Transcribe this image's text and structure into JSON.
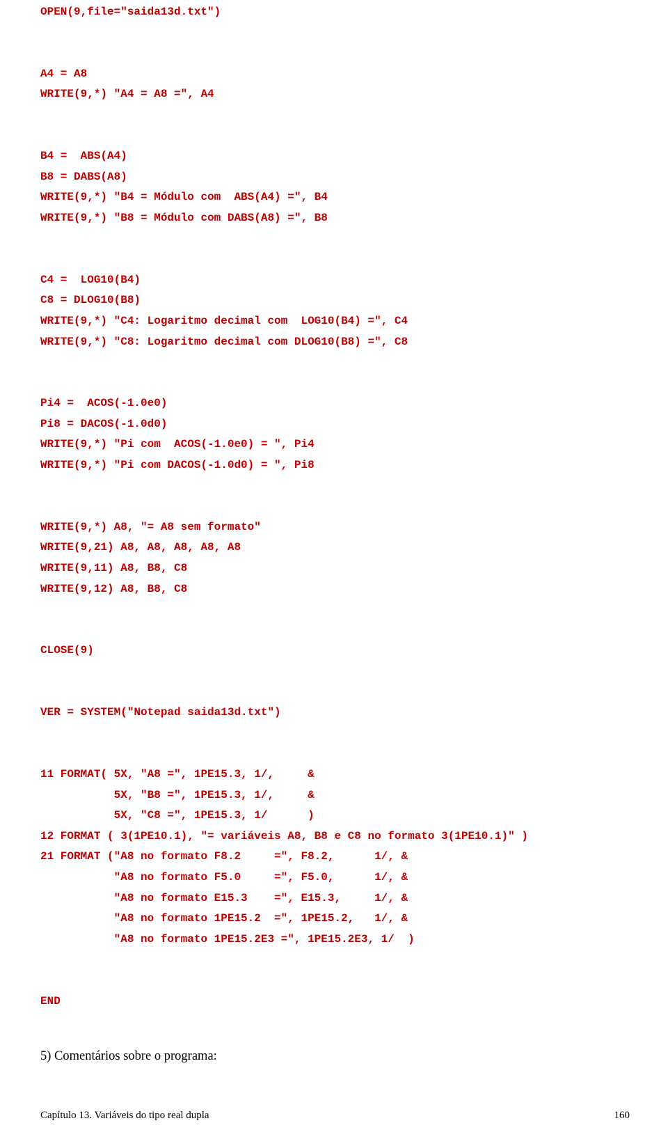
{
  "code": {
    "l01": "OPEN(9,file=\"saida13d.txt\")",
    "l02": "",
    "l03": "",
    "l04": "A4 = A8",
    "l05": "WRITE(9,*) \"A4 = A8 =\", A4",
    "l06": "",
    "l07": "",
    "l08": "B4 =  ABS(A4)",
    "l09": "B8 = DABS(A8)",
    "l10": "WRITE(9,*) \"B4 = Módulo com  ABS(A4) =\", B4",
    "l11": "WRITE(9,*) \"B8 = Módulo com DABS(A8) =\", B8",
    "l12": "",
    "l13": "",
    "l14": "C4 =  LOG10(B4)",
    "l15": "C8 = DLOG10(B8)",
    "l16": "WRITE(9,*) \"C4: Logaritmo decimal com  LOG10(B4) =\", C4",
    "l17": "WRITE(9,*) \"C8: Logaritmo decimal com DLOG10(B8) =\", C8",
    "l18": "",
    "l19": "",
    "l20": "Pi4 =  ACOS(-1.0e0)",
    "l21": "Pi8 = DACOS(-1.0d0)",
    "l22": "WRITE(9,*) \"Pi com  ACOS(-1.0e0) = \", Pi4",
    "l23": "WRITE(9,*) \"Pi com DACOS(-1.0d0) = \", Pi8",
    "l24": "",
    "l25": "",
    "l26": "WRITE(9,*) A8, \"= A8 sem formato\"",
    "l27": "WRITE(9,21) A8, A8, A8, A8, A8",
    "l28": "WRITE(9,11) A8, B8, C8",
    "l29": "WRITE(9,12) A8, B8, C8",
    "l30": "",
    "l31": "",
    "l32": "CLOSE(9)",
    "l33": "",
    "l34": "",
    "l35": "VER = SYSTEM(\"Notepad saida13d.txt\")",
    "l36": "",
    "l37": "",
    "l38": "11 FORMAT( 5X, \"A8 =\", 1PE15.3, 1/,     &",
    "l39": "           5X, \"B8 =\", 1PE15.3, 1/,     &",
    "l40": "           5X, \"C8 =\", 1PE15.3, 1/      )",
    "l41": "12 FORMAT ( 3(1PE10.1), \"= variáveis A8, B8 e C8 no formato 3(1PE10.1)\" )",
    "l42": "21 FORMAT (\"A8 no formato F8.2     =\", F8.2,      1/, &",
    "l43": "           \"A8 no formato F5.0     =\", F5.0,      1/, &",
    "l44": "           \"A8 no formato E15.3    =\", E15.3,     1/, &",
    "l45": "           \"A8 no formato 1PE15.2  =\", 1PE15.2,   1/, &",
    "l46": "           \"A8 no formato 1PE15.2E3 =\", 1PE15.2E3, 1/  )",
    "l47": "",
    "l48": "",
    "l49": "END"
  },
  "body": {
    "item5": "5)   Comentários sobre o programa:"
  },
  "footer": {
    "left": "Capítulo 13. Variáveis do tipo real dupla",
    "right": "160"
  }
}
